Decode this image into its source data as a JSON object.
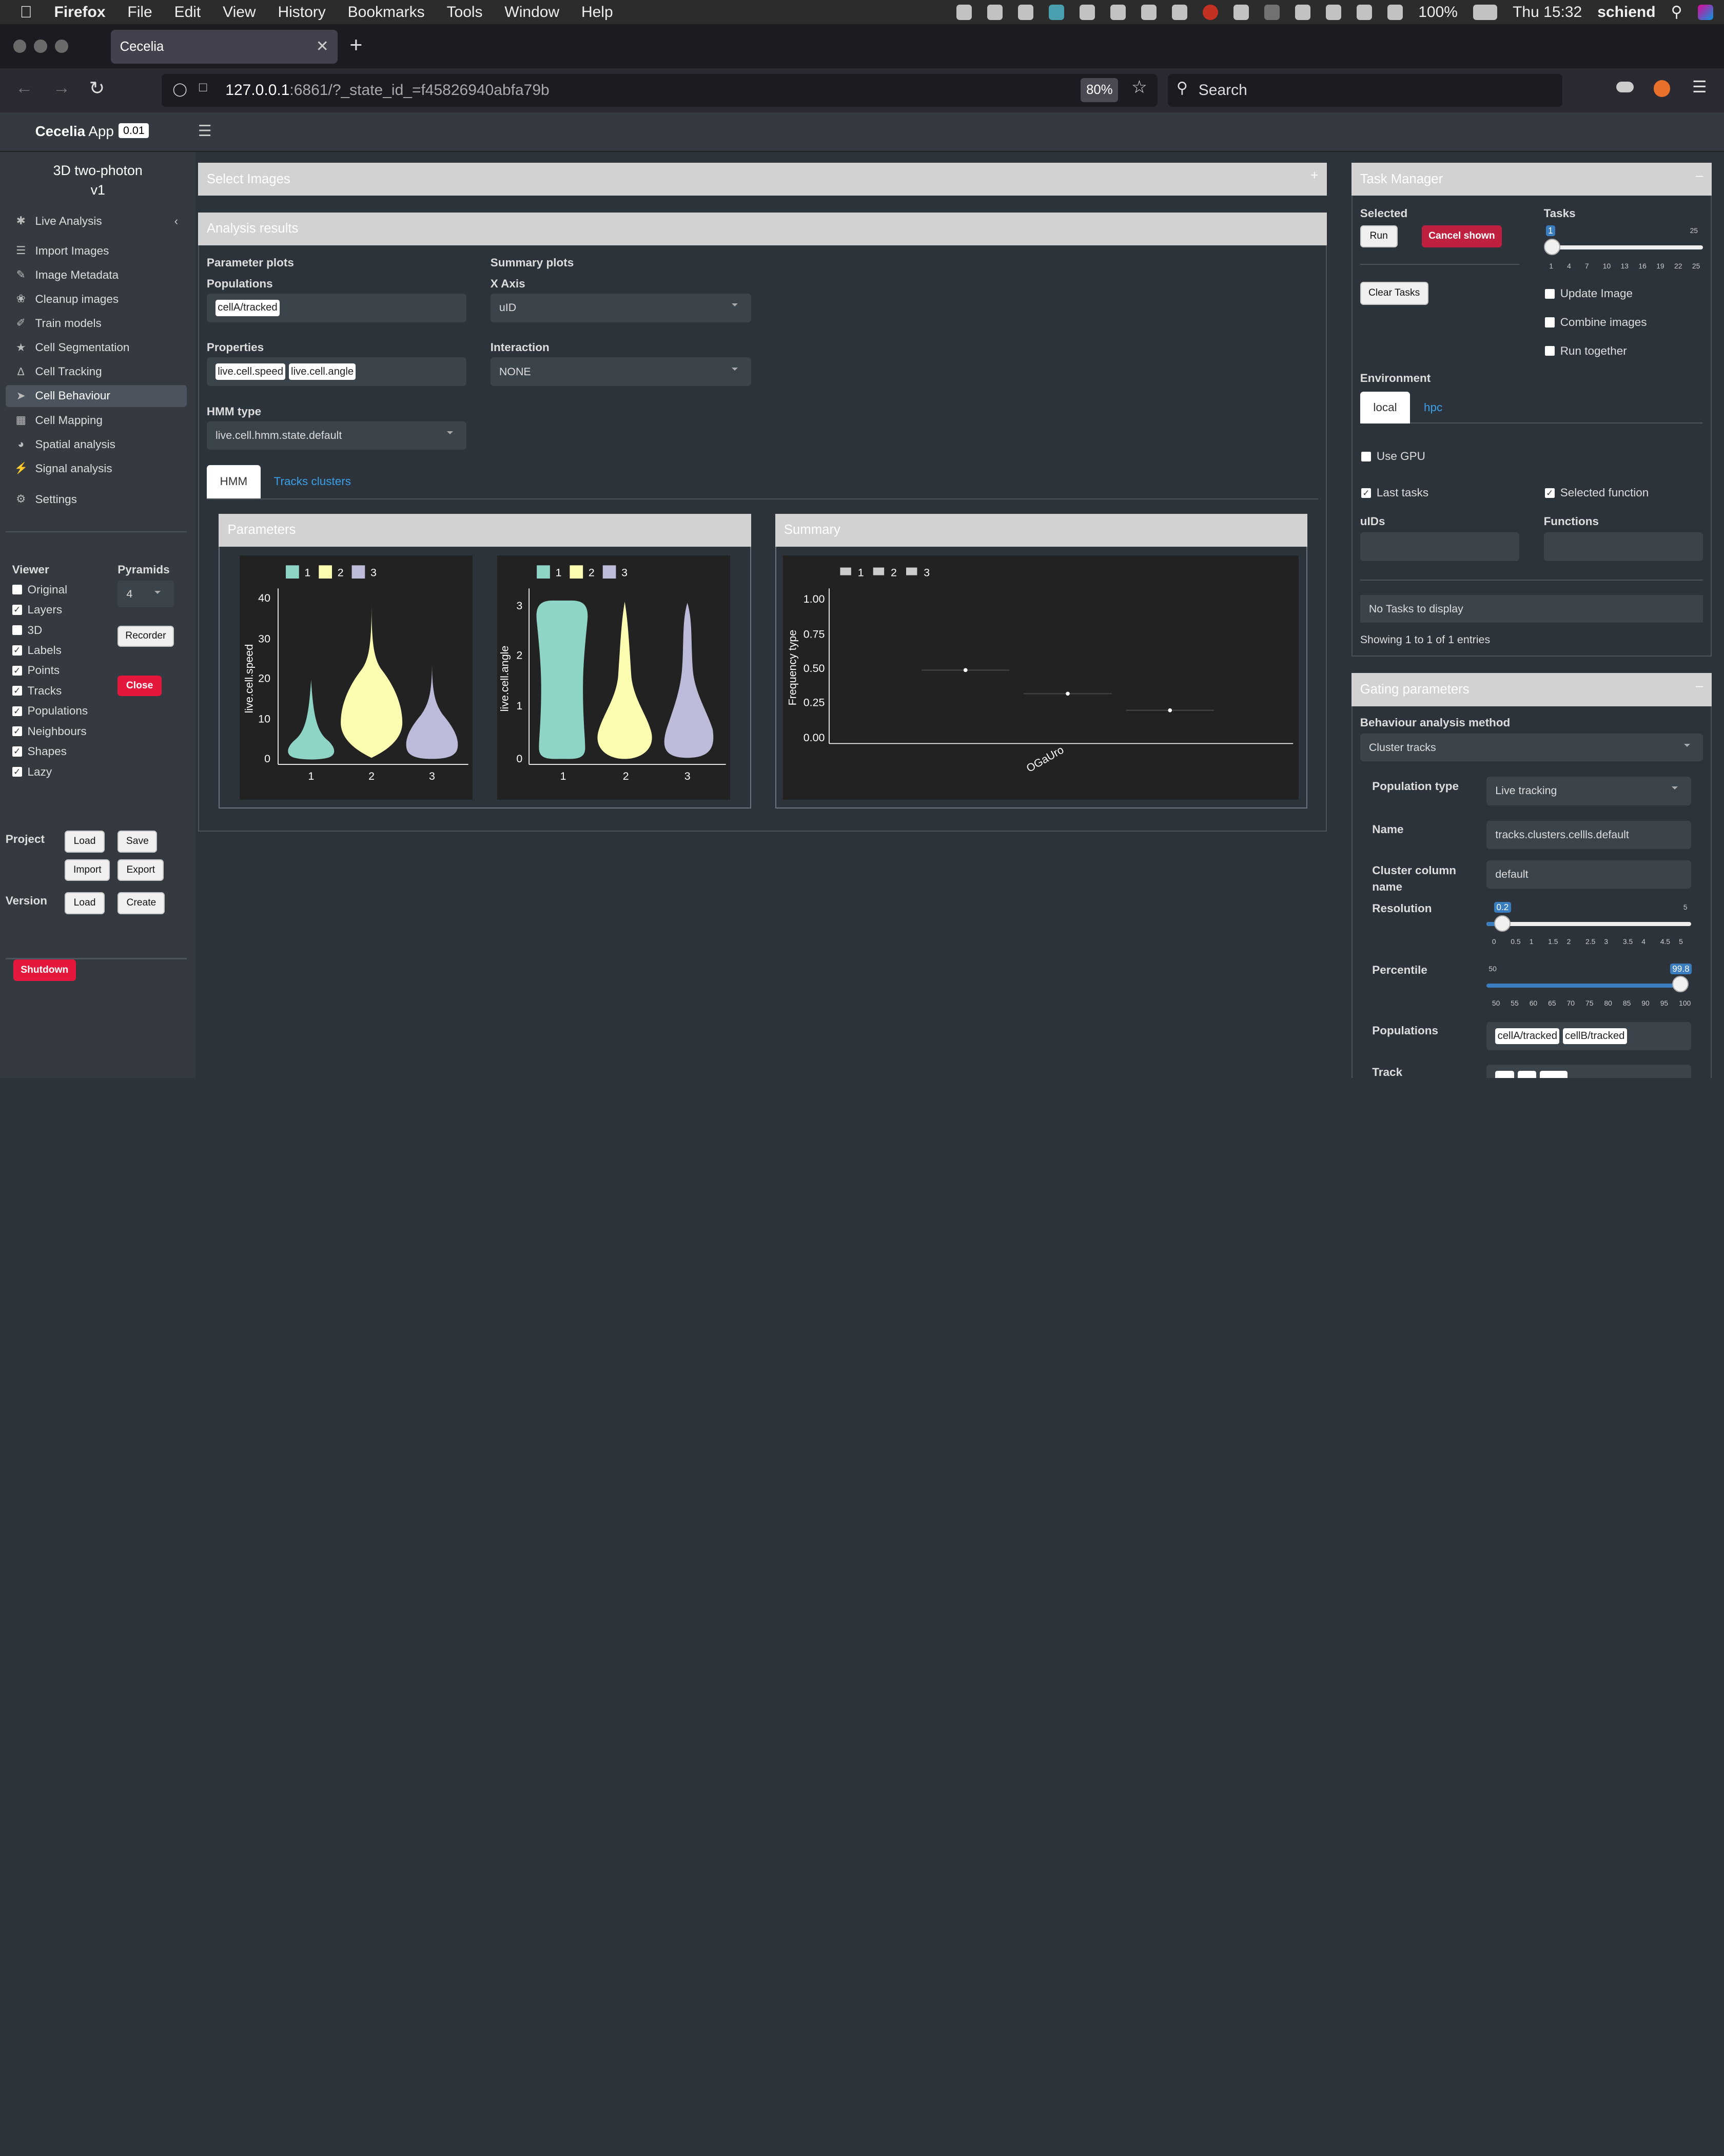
{
  "menubar": {
    "app": "Firefox",
    "items": [
      "File",
      "Edit",
      "View",
      "History",
      "Bookmarks",
      "Tools",
      "Window",
      "Help"
    ],
    "battery": "100%",
    "clock": "Thu 15:32",
    "user": "schiend"
  },
  "browser": {
    "tab_title": "Cecelia",
    "url_host": "127.0.0.1",
    "url_rest": ":6861/?_state_id_=f45826940abfa79b",
    "zoom": "80%",
    "search_placeholder": "Search"
  },
  "app": {
    "brand_bold": "Cecelia",
    "brand_thin": " App",
    "version": "0.01",
    "project_title": "3D two-photon",
    "project_version": "v1"
  },
  "sidebar": {
    "live_analysis": "Live Analysis",
    "items": [
      "Import Images",
      "Image Metadata",
      "Cleanup images",
      "Train models",
      "Cell Segmentation",
      "Cell Tracking",
      "Cell Behaviour",
      "Cell Mapping",
      "Spatial analysis",
      "Signal analysis"
    ],
    "icons": [
      "list-icon",
      "pen-icon",
      "broom-icon",
      "brush-icon",
      "star-icon",
      "route-icon",
      "rocket-icon",
      "map-icon",
      "pie-icon",
      "bolt-icon"
    ],
    "settings": "Settings",
    "viewer_label": "Viewer",
    "pyramids_label": "Pyramids",
    "pyramids_value": "4",
    "viewer_opts": [
      {
        "label": "Original",
        "checked": false
      },
      {
        "label": "Layers",
        "checked": true
      },
      {
        "label": "3D",
        "checked": false
      },
      {
        "label": "Labels",
        "checked": true
      },
      {
        "label": "Points",
        "checked": true
      },
      {
        "label": "Tracks",
        "checked": true
      },
      {
        "label": "Populations",
        "checked": true
      },
      {
        "label": "Neighbours",
        "checked": true
      },
      {
        "label": "Shapes",
        "checked": true
      },
      {
        "label": "Lazy",
        "checked": true
      }
    ],
    "recorder": "Recorder",
    "close": "Close",
    "project_label": "Project",
    "load": "Load",
    "save": "Save",
    "import": "Import",
    "export": "Export",
    "version_label": "Version",
    "vload": "Load",
    "create": "Create",
    "shutdown": "Shutdown"
  },
  "main": {
    "select_images": "Select Images",
    "analysis_results": "Analysis results",
    "param_plots": "Parameter plots",
    "populations_label": "Populations",
    "populations": [
      "cellA/tracked"
    ],
    "properties_label": "Properties",
    "properties": [
      "live.cell.speed",
      "live.cell.angle"
    ],
    "hmm_type_label": "HMM type",
    "hmm_type": "live.cell.hmm.state.default",
    "summary_plots": "Summary plots",
    "xaxis_label": "X Axis",
    "xaxis": "uID",
    "interaction_label": "Interaction",
    "interaction": "NONE",
    "tabs": [
      "HMM",
      "Tracks clusters"
    ],
    "parameters_title": "Parameters",
    "summary_title": "Summary"
  },
  "chart_data": [
    {
      "type": "violin",
      "ylabel": "live.cell.speed",
      "categories": [
        "1",
        "2",
        "3"
      ],
      "legend": [
        "1",
        "2",
        "3"
      ],
      "yticks": [
        "0",
        "10",
        "20",
        "30",
        "40"
      ],
      "ylim": [
        0,
        40
      ],
      "colors": [
        "#8fd5c6",
        "#fdfdb2",
        "#bdbbda"
      ]
    },
    {
      "type": "violin",
      "ylabel": "live.cell.angle",
      "categories": [
        "1",
        "2",
        "3"
      ],
      "legend": [
        "1",
        "2",
        "3"
      ],
      "yticks": [
        "0",
        "1",
        "2",
        "3"
      ],
      "ylim": [
        0,
        3.1
      ],
      "colors": [
        "#8fd5c6",
        "#fdfdb2",
        "#bdbbda"
      ]
    },
    {
      "type": "scatter",
      "ylabel": "Frequency type",
      "categories": [
        "OGaUro"
      ],
      "legend": [
        "1",
        "2",
        "3"
      ],
      "series": [
        {
          "name": "1",
          "values": [
            0.49
          ]
        },
        {
          "name": "2",
          "values": [
            0.32
          ]
        },
        {
          "name": "3",
          "values": [
            0.2
          ]
        }
      ],
      "yticks": [
        "0.00",
        "0.25",
        "0.50",
        "0.75",
        "1.00"
      ],
      "ylim": [
        0,
        1
      ]
    }
  ],
  "task_manager": {
    "title": "Task Manager",
    "selected_label": "Selected",
    "tasks_label": "Tasks",
    "run": "Run",
    "cancel": "Cancel shown",
    "clear": "Clear Tasks",
    "tasks_value": "1",
    "tasks_max": "25",
    "tasks_ticks": [
      "1",
      "4",
      "7",
      "10",
      "13",
      "16",
      "19",
      "22",
      "25"
    ],
    "update_image": "Update Image",
    "combine_images": "Combine images",
    "run_together": "Run together",
    "environment_label": "Environment",
    "env_tabs": [
      "local",
      "hpc"
    ],
    "use_gpu": "Use GPU",
    "last_tasks": "Last tasks",
    "selected_function": "Selected function",
    "uids_label": "uIDs",
    "functions_label": "Functions",
    "no_tasks": "No Tasks to display",
    "showing": "Showing 1 to 1 of 1 entries"
  },
  "gating": {
    "title": "Gating parameters",
    "method_label": "Behaviour analysis method",
    "method": "Cluster tracks",
    "pop_type_label": "Population type",
    "pop_type": "Live tracking",
    "name_label": "Name",
    "name_value": "tracks.clusters.cellls.default",
    "cluster_label_1": "Cluster column",
    "cluster_label_2": "name",
    "cluster_value": "default",
    "resolution_label": "Resolution",
    "resolution_value": "0.2",
    "resolution_max": "5",
    "resolution_ticks": [
      "0",
      "0.5",
      "1",
      "1.5",
      "2",
      "2.5",
      "3",
      "3.5",
      "4",
      "4.5",
      "5"
    ],
    "percentile_label": "Percentile",
    "percentile_min": "50",
    "percentile_value": "99.8",
    "percentile_ticks": [
      "50",
      "55",
      "60",
      "65",
      "70",
      "75",
      "80",
      "85",
      "90",
      "95",
      "100"
    ],
    "populations_label": "Populations",
    "populations": [
      "cellA/tracked",
      "cellB/tracked"
    ],
    "track_label": "Track"
  }
}
